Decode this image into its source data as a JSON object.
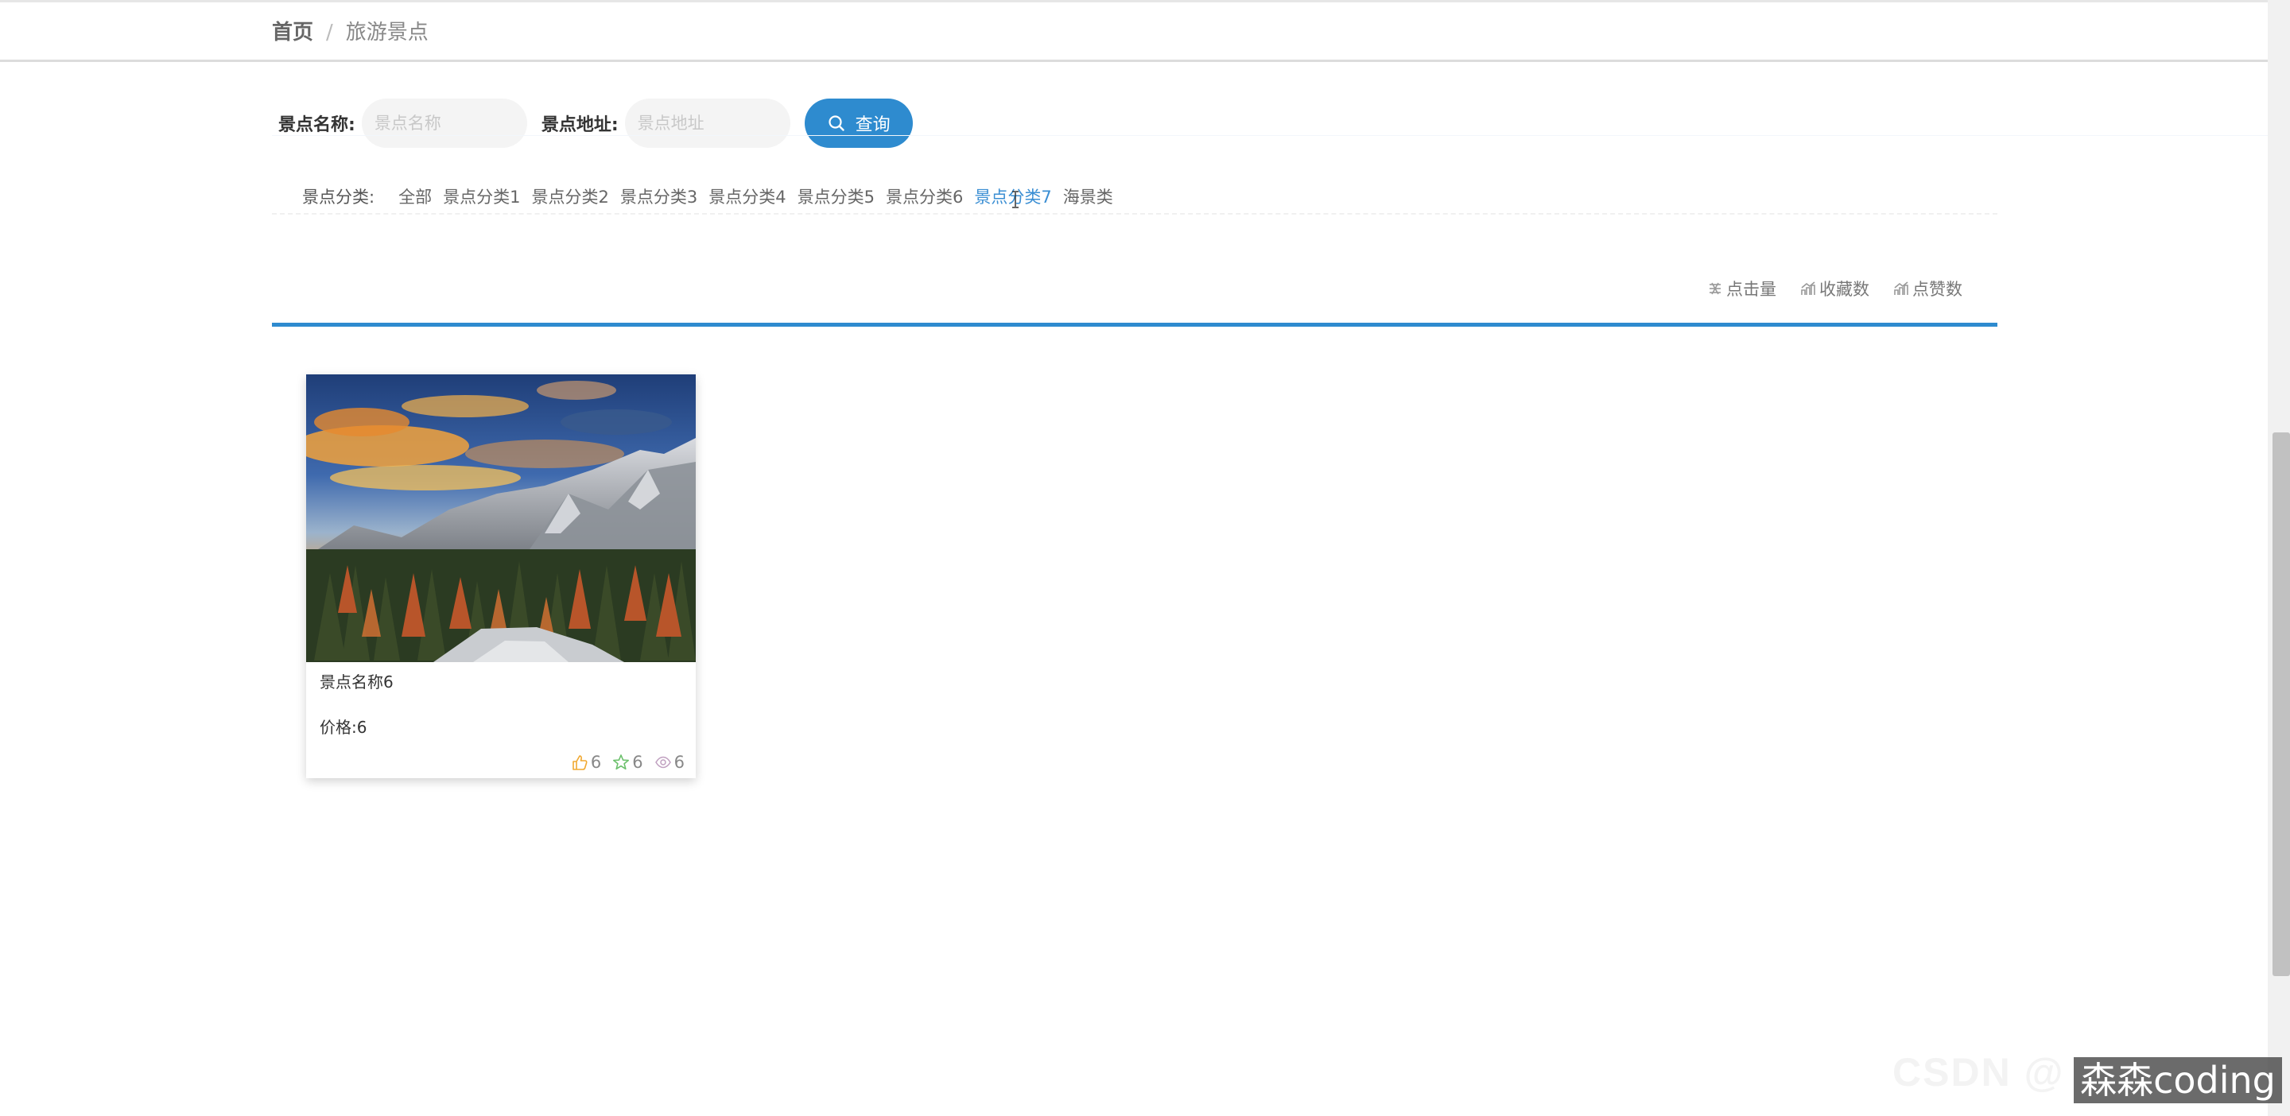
{
  "breadcrumb": {
    "home": "首页",
    "separator": "/",
    "current": "旅游景点"
  },
  "search": {
    "name_label": "景点名称:",
    "name_placeholder": "景点名称",
    "address_label": "景点地址:",
    "address_placeholder": "景点地址",
    "button_label": "查询",
    "button_icon": "search-icon"
  },
  "categories": {
    "label": "景点分类:",
    "items": [
      "全部",
      "景点分类1",
      "景点分类2",
      "景点分类3",
      "景点分类4",
      "景点分类5",
      "景点分类6",
      "景点分类7",
      "海景类"
    ],
    "active": "景点分类7"
  },
  "sort": {
    "items": [
      {
        "label": "点击量",
        "icon": "click-count-icon"
      },
      {
        "label": "收藏数",
        "icon": "trend-chart-icon"
      },
      {
        "label": "点赞数",
        "icon": "trend-chart-icon"
      }
    ]
  },
  "cards": [
    {
      "name": "景点名称6",
      "price": "价格:6",
      "likes": "6",
      "favorites": "6",
      "views": "6",
      "image": "mountain-sunset-forest-photo"
    }
  ],
  "watermark": {
    "faint": "CSDN @",
    "box": "森森coding"
  },
  "colors": {
    "accent": "#2e8bcf",
    "active_category": "#3a8ed3",
    "like": "#f0a830",
    "favorite": "#6cc06c",
    "view": "#c0a0c0"
  }
}
